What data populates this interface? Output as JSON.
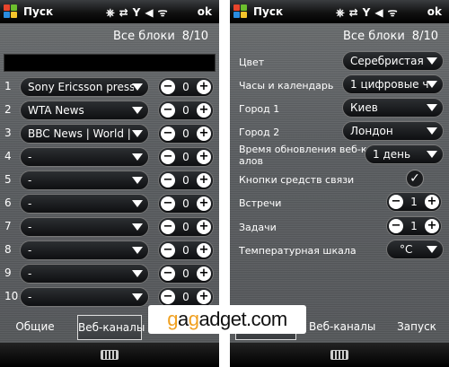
{
  "titlebar": {
    "title": "Пуск",
    "status_icons": "⎈⇄Y◀ᯤ",
    "ok": "ok"
  },
  "header": {
    "label": "Все блоки",
    "count": "8/10"
  },
  "left": {
    "rows": [
      {
        "num": "1",
        "source": "Sony Ericsson press re",
        "value": "0"
      },
      {
        "num": "2",
        "source": "WTA News",
        "value": "0"
      },
      {
        "num": "3",
        "source": "BBC News | World | U",
        "value": "0"
      },
      {
        "num": "4",
        "source": "-",
        "value": "0"
      },
      {
        "num": "5",
        "source": "-",
        "value": "0"
      },
      {
        "num": "6",
        "source": "-",
        "value": "0"
      },
      {
        "num": "7",
        "source": "-",
        "value": "0"
      },
      {
        "num": "8",
        "source": "-",
        "value": "0"
      },
      {
        "num": "9",
        "source": "-",
        "value": "0"
      },
      {
        "num": "10",
        "source": "-",
        "value": "0"
      }
    ],
    "tabs": [
      "Общие",
      "Веб-каналы",
      "Запуск"
    ]
  },
  "right": {
    "color": {
      "label": "Цвет",
      "value": "Серебристая"
    },
    "clock": {
      "label": "Часы и календарь",
      "value": "1 цифровые ча"
    },
    "city1": {
      "label": "Город 1",
      "value": "Киев"
    },
    "city2": {
      "label": "Город 2",
      "value": "Лондон"
    },
    "update": {
      "label_line1": "Время обновления  веб-кан",
      "label_line2": "алов",
      "value": "1 день"
    },
    "comm": {
      "label": "Кнопки средств связи",
      "checked": true
    },
    "meetings": {
      "label": "Встречи",
      "value": "1"
    },
    "tasks": {
      "label": "Задачи",
      "value": "1"
    },
    "temp": {
      "label": "Температурная шкала",
      "value": "°C"
    },
    "tabs": [
      "Общие",
      "Веб-каналы",
      "Запуск"
    ]
  },
  "watermark": {
    "part1": "g",
    "part2": "a",
    "part3": "g",
    "part4": "adget.com"
  },
  "colors": {
    "accent": "#f0a020",
    "screen_bg": "#5a5d60"
  }
}
